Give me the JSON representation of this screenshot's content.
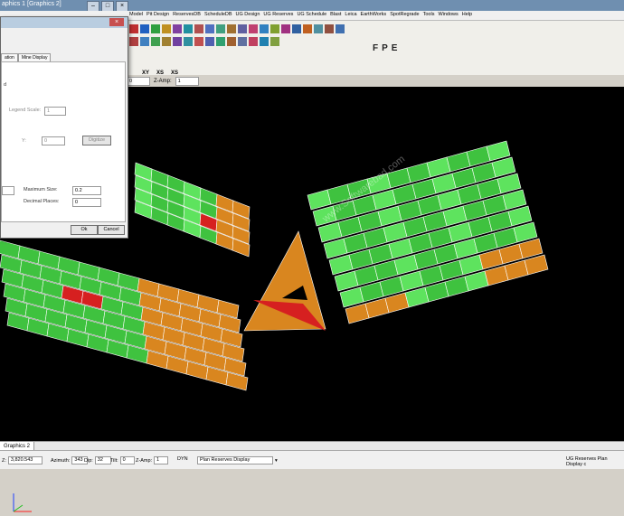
{
  "window": {
    "title": "aphics 1 [Graphics 2]"
  },
  "menu": {
    "items": [
      "Model",
      "Pit Design",
      "ReservesDB",
      "ScheduleDB",
      "UG Design",
      "UG Reserves",
      "UG Schedule",
      "Blast",
      "Leica",
      "EarthWorks",
      "SpotRegrade",
      "Tools",
      "Windows",
      "Help"
    ]
  },
  "toolbar": {
    "letters": [
      "F",
      "P",
      "E"
    ],
    "view_buttons": [
      "XY",
      "XS",
      "XS"
    ],
    "zamp_label": "Z-Amp:",
    "zamp_value": "1",
    "zero_value": "0"
  },
  "dialog": {
    "tabs": [
      "ation",
      "Mine Display"
    ],
    "partial_label": "d",
    "legend_scale_label": "Legend Scale:",
    "legend_scale_value": "1",
    "y_label": "Y:",
    "y_value": "0",
    "digitize_label": "Digitize",
    "max_size_label": "Maximum Size:",
    "max_size_value": "0.2",
    "decimal_label": "Decimal Places:",
    "decimal_value": "0",
    "ok_label": "Ok",
    "cancel_label": "Cancel"
  },
  "tabs": {
    "active": "Graphics 2"
  },
  "status": {
    "z_label": "Z:",
    "z_value": "3,820.543",
    "azimuth_label": "Azimuth:",
    "azimuth_value": "343",
    "dip_label": "Dip:",
    "dip_value": "32",
    "tilt_label": "Tilt:",
    "tilt_value": "0",
    "zamp_label": "Z-Amp:",
    "zamp_value": "1",
    "dyn_label": "DYN",
    "display_select": "Plan Reserves Display",
    "right_text": "UG Reserves Plan Display c"
  },
  "watermark": "www.Softwarebad.com",
  "colors": {
    "green": "#3fc23f",
    "bright_green": "#5ee35e",
    "orange": "#d9861f",
    "red": "#d62020",
    "background": "#000000"
  }
}
